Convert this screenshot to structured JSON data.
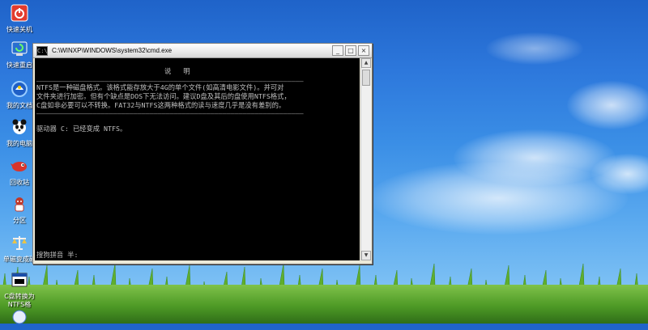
{
  "desktop": {
    "icons": [
      {
        "label": "快速关机",
        "icon": "power-icon"
      },
      {
        "label": "快速重启",
        "icon": "restart-icon"
      },
      {
        "label": "我的文档",
        "icon": "documents-icon"
      },
      {
        "label": "我的电脑",
        "icon": "computer-icon"
      },
      {
        "label": "回收站",
        "icon": "recycle-bin-icon"
      },
      {
        "label": "分区",
        "icon": "partition-icon"
      },
      {
        "label": "单磁变成磁",
        "icon": "scales-icon"
      },
      {
        "label": "C盘转换为",
        "icon": "convert-icon"
      },
      {
        "label": "NTFS格",
        "icon": "ntfs-icon"
      }
    ]
  },
  "window": {
    "title": "C:\\WINXP\\WINDOWS\\system32\\cmd.exe",
    "app_icon": "C:\\",
    "buttons": {
      "minimize": "_",
      "maximize": "□",
      "close": "×"
    }
  },
  "console": {
    "heading": "说   明",
    "separator": "——————————————————————————————————————————————————————————————————",
    "lines": [
      "NTFS是一种磁盘格式。该格式能存放大于4G的单个文件(如高清电影文件)。并可对",
      "文件夹进行加密。但有个缺点是DOS下无法访问。建议D盘及其后的盘使用NTFS格式，",
      "C盘如非必要可以不转换。FAT32与NTFS这两种格式的读与速度几乎是没有差别的。"
    ],
    "result": "驱动器 C: 已经变成 NTFS。",
    "ime": "搜狗拼音 半:"
  }
}
